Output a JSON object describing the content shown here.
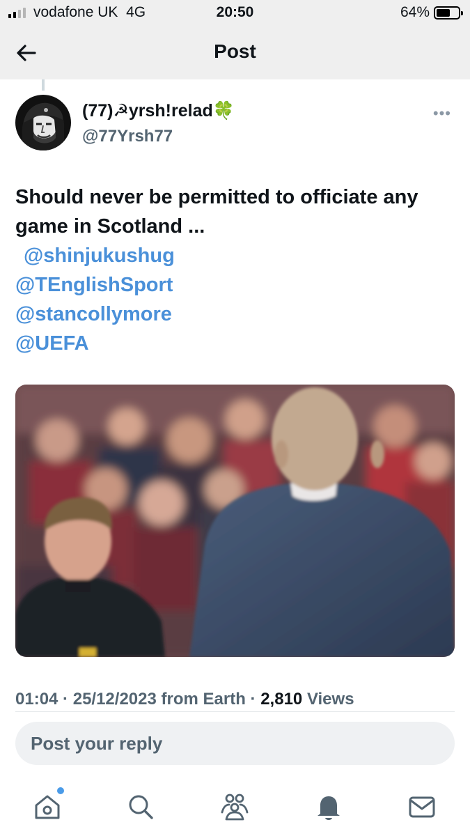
{
  "status_bar": {
    "carrier": "vodafone UK",
    "network": "4G",
    "time": "20:50",
    "battery_percent": "64%",
    "battery_level": 0.64
  },
  "nav": {
    "title": "Post"
  },
  "post": {
    "author": {
      "display_name": "(77)☭yrsh!relad🍀",
      "handle": "@77Yrsh77"
    },
    "text": "Should never be permitted to officiate any game in Scotland ...",
    "mentions": [
      "@shinjukushug",
      "@TEnglishSport",
      "@stancollymore",
      "@UEFA"
    ],
    "meta": {
      "time": "01:04",
      "date": "25/12/2023",
      "source": "from Earth",
      "views_count": "2,810",
      "views_label": "Views"
    }
  },
  "reply": {
    "placeholder": "Post your reply"
  },
  "tab_bar": {
    "items": [
      "home-icon",
      "search-icon",
      "communities-icon",
      "notifications-icon",
      "messages-icon"
    ],
    "home_has_notification_dot": true
  },
  "colors": {
    "link": "#4a90d9",
    "secondary_text": "#536471",
    "bar_background": "#efefef"
  }
}
